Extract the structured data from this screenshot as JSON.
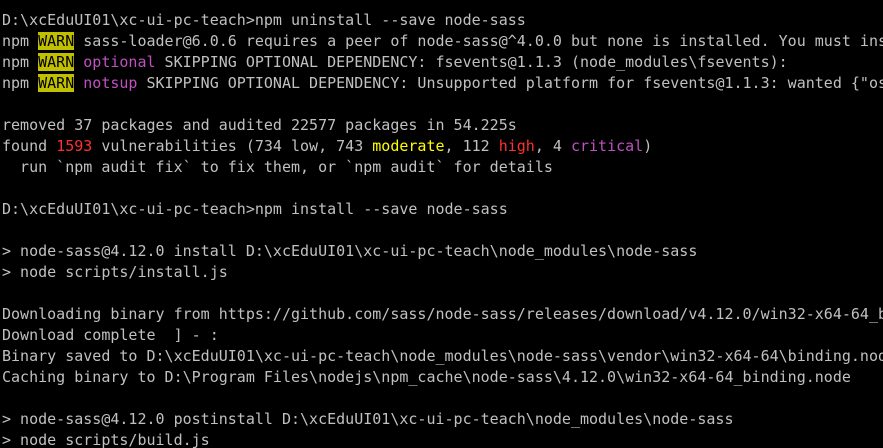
{
  "terminal": {
    "colors": {
      "background": "#000000",
      "default": "#c0c0c0",
      "warn_bg": "#c0c000",
      "magenta": "#c050c0",
      "red": "#ff3030",
      "yellow": "#ffff00"
    },
    "lines": [
      [
        {
          "t": "D:\\xcEduUI01\\xc-ui-pc-teach>npm uninstall --save node-sass",
          "s": "default"
        }
      ],
      [
        {
          "t": "npm ",
          "s": "default"
        },
        {
          "t": "WARN",
          "s": "warn"
        },
        {
          "t": " sass-loader@6.0.6 requires a peer of node-sass@^4.0.0 but none is installed. You must ins",
          "s": "default"
        }
      ],
      [
        {
          "t": "npm ",
          "s": "default"
        },
        {
          "t": "WARN",
          "s": "warn"
        },
        {
          "t": " ",
          "s": "default"
        },
        {
          "t": "optional",
          "s": "magenta"
        },
        {
          "t": " SKIPPING OPTIONAL DEPENDENCY: fsevents@1.1.3 (node_modules\\fsevents):",
          "s": "default"
        }
      ],
      [
        {
          "t": "npm ",
          "s": "default"
        },
        {
          "t": "WARN",
          "s": "warn"
        },
        {
          "t": " ",
          "s": "default"
        },
        {
          "t": "notsup",
          "s": "magenta"
        },
        {
          "t": " SKIPPING OPTIONAL DEPENDENCY: Unsupported platform for fsevents@1.1.3: wanted {\"os",
          "s": "default"
        }
      ],
      [],
      [
        {
          "t": "removed 37 packages and audited 22577 packages in 54.225s",
          "s": "default"
        }
      ],
      [
        {
          "t": "found ",
          "s": "default"
        },
        {
          "t": "1593",
          "s": "red"
        },
        {
          "t": " vulnerabilities (734 low, 743 ",
          "s": "default"
        },
        {
          "t": "moderate",
          "s": "yellow"
        },
        {
          "t": ", 112 ",
          "s": "default"
        },
        {
          "t": "high",
          "s": "red"
        },
        {
          "t": ", 4 ",
          "s": "default"
        },
        {
          "t": "critical",
          "s": "magenta"
        },
        {
          "t": ")",
          "s": "default"
        }
      ],
      [
        {
          "t": "  run `npm audit fix` to fix them, or `npm audit` for details",
          "s": "default"
        }
      ],
      [],
      [
        {
          "t": "D:\\xcEduUI01\\xc-ui-pc-teach>npm install --save node-sass",
          "s": "default"
        }
      ],
      [],
      [
        {
          "t": "> node-sass@4.12.0 install D:\\xcEduUI01\\xc-ui-pc-teach\\node_modules\\node-sass",
          "s": "default"
        }
      ],
      [
        {
          "t": "> node scripts/install.js",
          "s": "default"
        }
      ],
      [],
      [
        {
          "t": "Downloading binary from https://github.com/sass/node-sass/releases/download/v4.12.0/win32-x64-64_b",
          "s": "default"
        }
      ],
      [
        {
          "t": "Download complete  ] - :",
          "s": "default"
        }
      ],
      [
        {
          "t": "Binary saved to D:\\xcEduUI01\\xc-ui-pc-teach\\node_modules\\node-sass\\vendor\\win32-x64-64\\binding.nod",
          "s": "default"
        }
      ],
      [
        {
          "t": "Caching binary to D:\\Program Files\\nodejs\\npm_cache\\node-sass\\4.12.0\\win32-x64-64_binding.node",
          "s": "default"
        }
      ],
      [],
      [
        {
          "t": "> node-sass@4.12.0 postinstall D:\\xcEduUI01\\xc-ui-pc-teach\\node_modules\\node-sass",
          "s": "default"
        }
      ],
      [
        {
          "t": "> node scripts/build.js",
          "s": "default"
        }
      ]
    ]
  }
}
